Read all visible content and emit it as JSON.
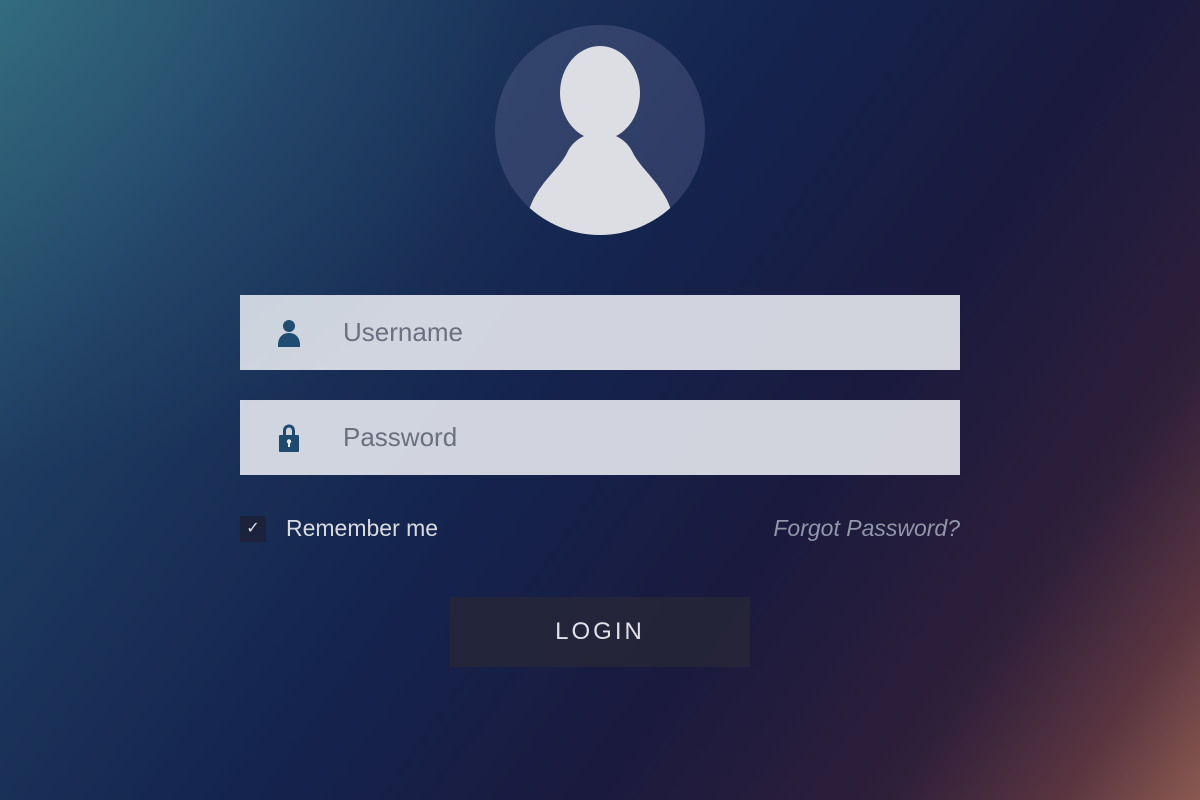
{
  "form": {
    "username": {
      "placeholder": "Username",
      "value": ""
    },
    "password": {
      "placeholder": "Password",
      "value": ""
    },
    "remember": {
      "label": "Remember me",
      "checked": true
    },
    "forgot_link": "Forgot Password?",
    "login_button": "LOGIN"
  },
  "colors": {
    "icon_color": "#1e4a6e",
    "input_bg": "#e6e8ee",
    "text_muted": "#6b7080"
  }
}
